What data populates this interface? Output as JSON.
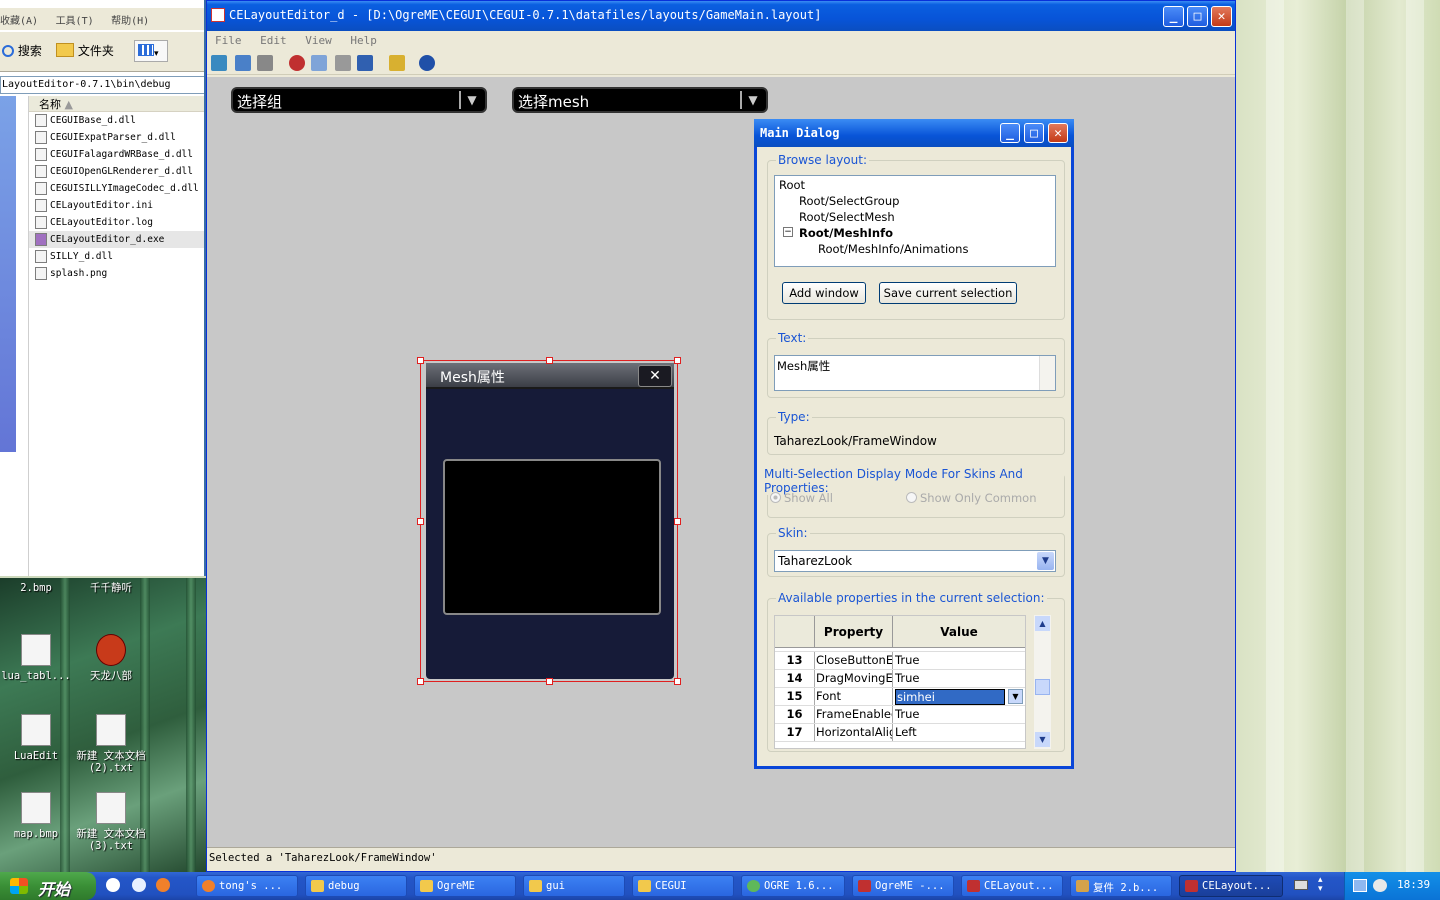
{
  "explorer": {
    "menu": [
      "收藏(A)",
      "工具(T)",
      "帮助(H)"
    ],
    "toolbar": {
      "search": "搜索",
      "folders": "文件夹"
    },
    "address": "LayoutEditor-0.7.1\\bin\\debug",
    "column_header": "名称",
    "files": [
      "CEGUIBase_d.dll",
      "CEGUIExpatParser_d.dll",
      "CEGUIFalagardWRBase_d.dll",
      "CEGUIOpenGLRenderer_d.dll",
      "CEGUISILLYImageCodec_d.dll",
      "CELayoutEditor.ini",
      "CELayoutEditor.log",
      "CELayoutEditor_d.exe",
      "SILLY_d.dll",
      "splash.png"
    ]
  },
  "desktop_icons": [
    "2.bmp",
    "千千静听",
    "lua_tabl...",
    "天龙八部",
    "LuaEdit",
    "新建 文本文档 (2).txt",
    "map.bmp",
    "新建 文本文档 (3).txt"
  ],
  "window": {
    "title": "CELayoutEditor_d - [D:\\OgreME\\CEGUI\\CEGUI-0.7.1\\datafiles/layouts/GameMain.layout]",
    "menu": [
      "File",
      "Edit",
      "View",
      "Help"
    ],
    "status": "Selected a 'TaharezLook/FrameWindow'"
  },
  "canvas": {
    "combo_group": "选择组",
    "combo_mesh": "选择mesh",
    "mesh_window_title": "Mesh属性"
  },
  "dialog": {
    "title": "Main Dialog",
    "browse_label": "Browse layout:",
    "tree": [
      "Root",
      "Root/SelectGroup",
      "Root/SelectMesh",
      "Root/MeshInfo",
      "Root/MeshInfo/Animations"
    ],
    "add_window": "Add window",
    "save_selection": "Save current selection",
    "text_label": "Text:",
    "text_value": "Mesh属性",
    "type_label": "Type:",
    "type_value": "TaharezLook/FrameWindow",
    "multi_label": "Multi-Selection Display Mode For Skins And Properties:",
    "show_all": "Show All",
    "show_common": "Show Only Common",
    "skin_label": "Skin:",
    "skin_value": "TaharezLook",
    "props_label": "Available properties in the current selection:",
    "col_property": "Property",
    "col_value": "Value",
    "rows": [
      {
        "n": "13",
        "k": "CloseButtonEr",
        "v": "True"
      },
      {
        "n": "14",
        "k": "DragMovingEn",
        "v": "True"
      },
      {
        "n": "15",
        "k": "Font",
        "v": "simhei"
      },
      {
        "n": "16",
        "k": "FrameEnabled",
        "v": "True"
      },
      {
        "n": "17",
        "k": "HorizontalAlign",
        "v": "Left"
      }
    ]
  },
  "taskbar": {
    "start": "开始",
    "tasks": [
      "tong's ...",
      "debug",
      "OgreME",
      "gui",
      "CEGUI",
      "OGRE 1.6...",
      "OgreME -...",
      "CELayout...",
      "复件 2.b...",
      "CELayout..."
    ],
    "clock": "18:39"
  }
}
